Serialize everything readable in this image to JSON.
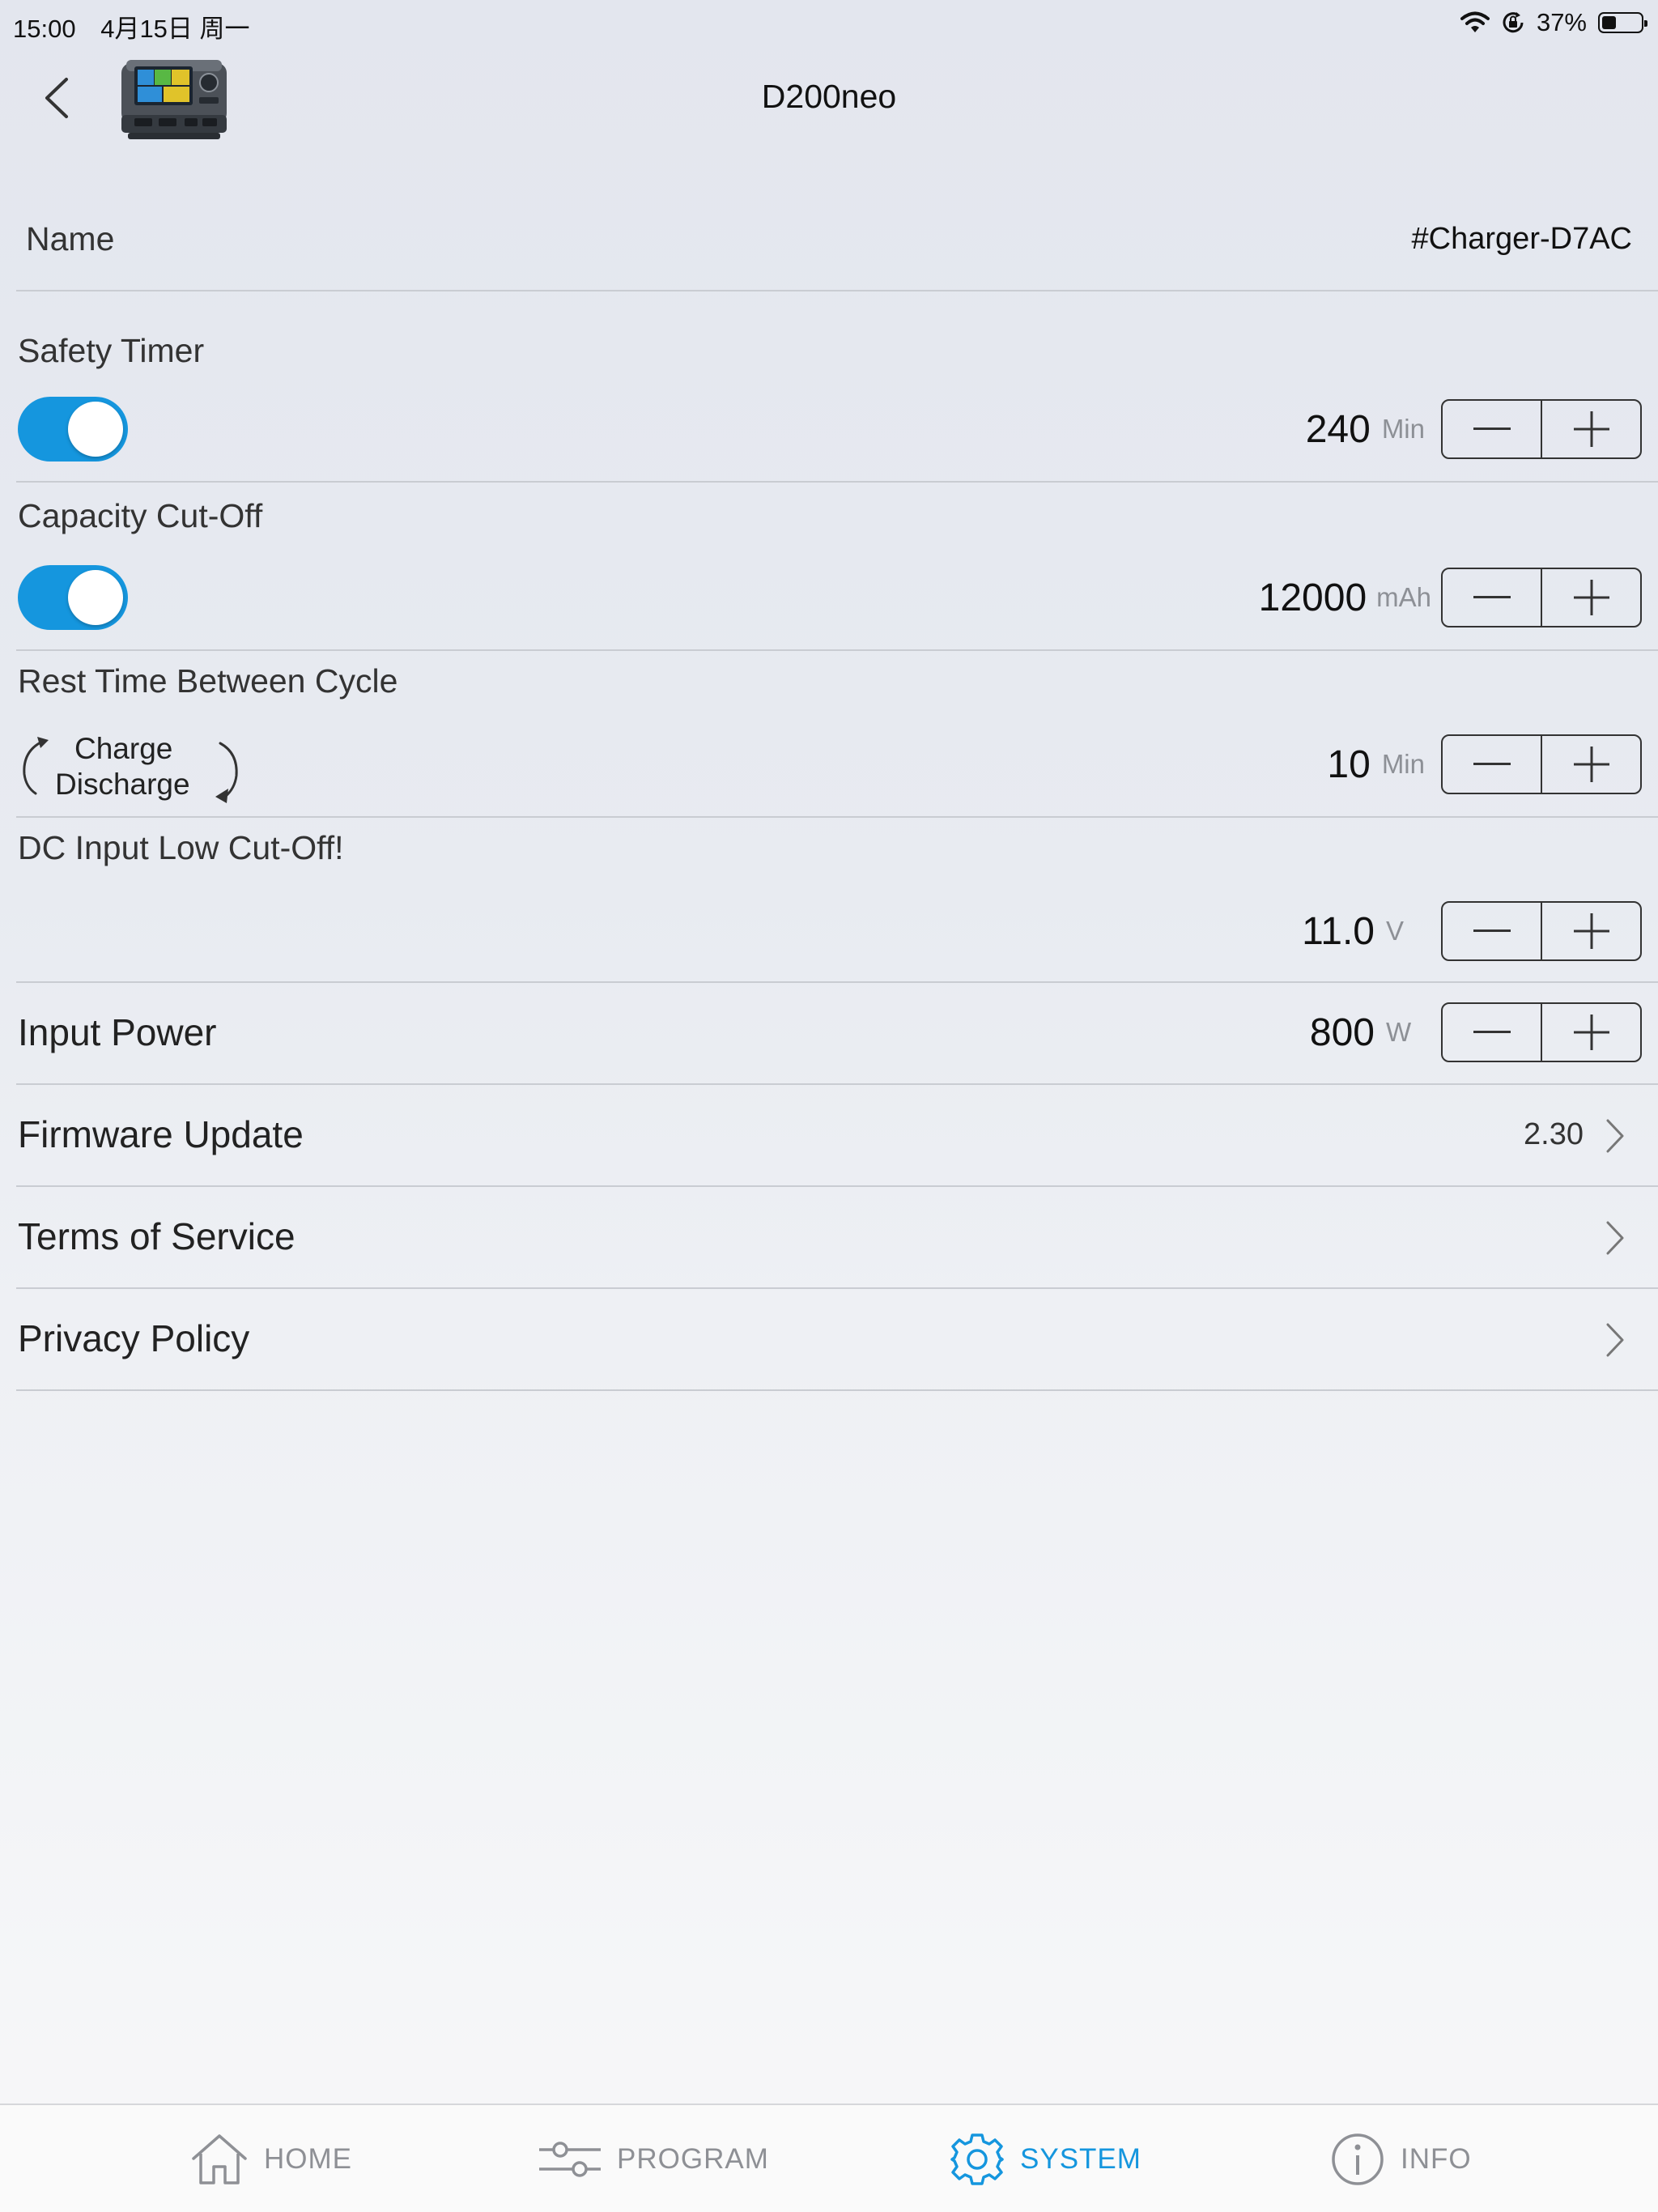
{
  "status_bar": {
    "time": "15:00",
    "date": "4月15日 周一",
    "battery_percent": "37%",
    "battery_level": 0.37,
    "icons": [
      "wifi-icon",
      "orientation-lock-icon",
      "battery-icon"
    ]
  },
  "nav": {
    "title": "D200neo",
    "back_icon": "chevron-left-icon",
    "device_image": "charger-device-image"
  },
  "settings": {
    "name": {
      "label": "Name",
      "value": "#Charger-D7AC"
    },
    "safety_timer": {
      "label": "Safety Timer",
      "enabled": true,
      "value": "240",
      "unit": "Min"
    },
    "capacity_cutoff": {
      "label": "Capacity Cut-Off",
      "enabled": true,
      "value": "12000",
      "unit": "mAh"
    },
    "rest_time": {
      "label": "Rest Time Between Cycle",
      "cycle_top": "Charge",
      "cycle_bottom": "Discharge",
      "value": "10",
      "unit": "Min"
    },
    "dc_input": {
      "label": "DC Input Low Cut-Off!",
      "value": "11.0",
      "unit": "V"
    },
    "input_power": {
      "label": "Input Power",
      "value": "800",
      "unit": "W"
    },
    "firmware": {
      "label": "Firmware Update",
      "value": "2.30"
    },
    "terms": {
      "label": "Terms of Service"
    },
    "privacy": {
      "label": "Privacy Policy"
    }
  },
  "tabs": [
    {
      "label": "HOME",
      "icon": "home-icon",
      "active": false
    },
    {
      "label": "PROGRAM",
      "icon": "sliders-icon",
      "active": false
    },
    {
      "label": "SYSTEM",
      "icon": "gear-icon",
      "active": true
    },
    {
      "label": "INFO",
      "icon": "info-icon",
      "active": false
    }
  ],
  "colors": {
    "accent": "#1596de",
    "divider": "#c9ccd2",
    "unit_text": "#8d9096",
    "tab_inactive": "#8e9095"
  }
}
